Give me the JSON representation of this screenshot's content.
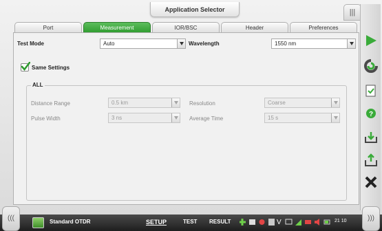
{
  "app_selector": {
    "label": "Application Selector"
  },
  "right_tabs": [
    "|||",
    "|||"
  ],
  "tabs": [
    {
      "label": "Port"
    },
    {
      "label": "Measurement"
    },
    {
      "label": "IOR/BSC"
    },
    {
      "label": "Header"
    },
    {
      "label": "Preferences"
    }
  ],
  "measurement": {
    "test_mode_label": "Test Mode",
    "test_mode_value": "Auto",
    "wavelength_label": "Wavelength",
    "wavelength_value": "1550 nm",
    "same_settings_label": "Same Settings",
    "same_settings_checked": true,
    "group_label": "ALL",
    "distance_range_label": "Distance Range",
    "distance_range_value": "0.5 km",
    "resolution_label": "Resolution",
    "resolution_value": "Coarse",
    "pulse_width_label": "Pulse Width",
    "pulse_width_value": "3 ns",
    "average_time_label": "Average Time",
    "average_time_value": "15 s"
  },
  "bottom_bar": {
    "left_nav": "(((",
    "right_nav": ")))",
    "app_name": "Standard OTDR",
    "setup": "SETUP",
    "test": "TEST",
    "result": "RESULT",
    "status_v": "V",
    "time": "21 10"
  },
  "toolbar_icons": [
    "play-icon",
    "refresh-icon",
    "report-icon",
    "help-icon",
    "load-icon",
    "save-icon",
    "close-icon"
  ],
  "colors": {
    "accent": "#2e9b2e",
    "active_tab": "#3aa83a",
    "bar": "#2a2a2a"
  }
}
